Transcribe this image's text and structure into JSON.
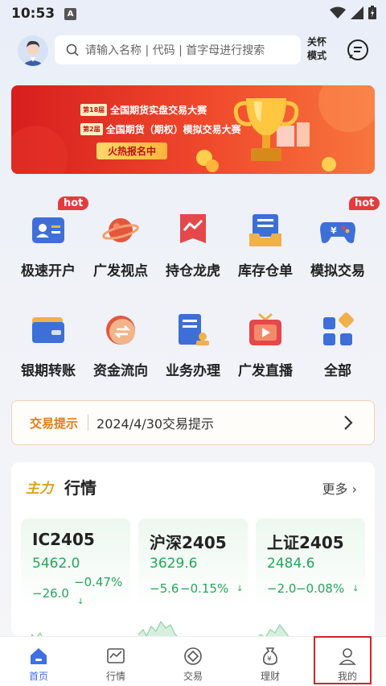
{
  "status_bar": {
    "time": "10:53",
    "notification_letter": "A"
  },
  "header": {
    "search_placeholder": "请输入名称 | 代码 | 首字母进行搜索",
    "care_mode": "关怀模式"
  },
  "banner": {
    "row1_tag": "第18届",
    "row1_text": "全国期货实盘交易大赛",
    "row2_tag": "第2届",
    "row2_text": "全国期货（期权）模拟交易大赛",
    "cta": "火热报名中"
  },
  "grid": [
    {
      "label": "极速开户",
      "icon": "id-card-icon",
      "hot": true
    },
    {
      "label": "广发视点",
      "icon": "planet-icon",
      "hot": false
    },
    {
      "label": "持仓龙虎",
      "icon": "trend-flag-icon",
      "hot": false
    },
    {
      "label": "库存仓单",
      "icon": "inbox-icon",
      "hot": false
    },
    {
      "label": "模拟交易",
      "icon": "gamepad-icon",
      "hot": true
    },
    {
      "label": "银期转账",
      "icon": "wallet-icon",
      "hot": false
    },
    {
      "label": "资金流向",
      "icon": "exchange-coin-icon",
      "hot": false
    },
    {
      "label": "业务办理",
      "icon": "document-stamp-icon",
      "hot": false
    },
    {
      "label": "广发直播",
      "icon": "tv-play-icon",
      "hot": false
    },
    {
      "label": "全部",
      "icon": "apps-grid-icon",
      "hot": false
    }
  ],
  "hot_label": "hot",
  "tips": {
    "title": "交易提示",
    "text": "2024/4/30交易提示"
  },
  "market": {
    "logo": "主力",
    "title": "行情",
    "more": "更多",
    "cards": [
      {
        "name": "IC2405",
        "price": "5462.0",
        "change": "−26.0",
        "pct": "−0.47%"
      },
      {
        "name": "沪深2405",
        "price": "3629.6",
        "change": "−5.6",
        "pct": "−0.15%"
      },
      {
        "name": "上证2405",
        "price": "2484.6",
        "change": "−2.0",
        "pct": "−0.08%"
      }
    ]
  },
  "nav": [
    {
      "label": "首页",
      "icon": "home-icon",
      "active": true
    },
    {
      "label": "行情",
      "icon": "chart-icon",
      "active": false
    },
    {
      "label": "交易",
      "icon": "trade-icon",
      "active": false
    },
    {
      "label": "理财",
      "icon": "money-bag-icon",
      "active": false
    },
    {
      "label": "我的",
      "icon": "user-icon",
      "active": false
    }
  ],
  "colors": {
    "up_down_green": "#26a55a",
    "accent_blue": "#3d6fe6",
    "hot_red": "#e63b3b",
    "tips_orange": "#e47b12"
  }
}
